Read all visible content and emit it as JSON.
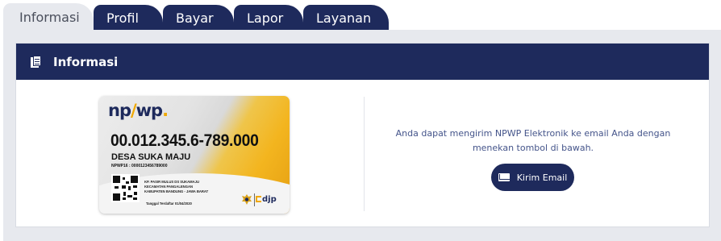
{
  "tabs": [
    {
      "label": "Informasi",
      "active": true
    },
    {
      "label": "Profil",
      "active": false
    },
    {
      "label": "Bayar",
      "active": false
    },
    {
      "label": "Lapor",
      "active": false
    },
    {
      "label": "Layanan",
      "active": false
    }
  ],
  "card": {
    "title": "Informasi",
    "title_icon": "document-copy-icon"
  },
  "npwp_card": {
    "logo_prefix": "np",
    "logo_suffix": "wp",
    "logo_dot": ".",
    "number": "00.012.345.6-789.000",
    "name": "DESA SUKA MAJU",
    "npwp16": "NPWP16 : 0000123456789000",
    "address": [
      "KP. PASIR MULUS DS SUKAMAJU",
      "KECAMATAN PANGALENGAN",
      "KABUPATEN BANDUNG - JAWA BARAT"
    ],
    "registered": "Tanggal Terdaftar 01/04/2020",
    "brand": "djp"
  },
  "message": "Anda dapat mengirim NPWP Elektronik ke email Anda dengan menekan tombol di bawah.",
  "email_button": {
    "label": "Kirim Email",
    "icon": "envelope-icon"
  },
  "colors": {
    "navy": "#1e2a5c",
    "panel": "#e7e9ee",
    "text_blue": "#44548a",
    "gold": "#f0a800"
  }
}
